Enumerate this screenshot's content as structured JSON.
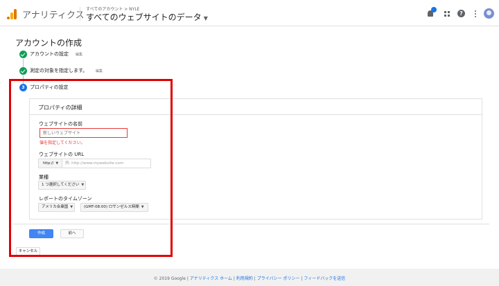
{
  "header": {
    "app_name": "アナリティクス",
    "breadcrumb": "すべてのアカウント > NYLE",
    "property_selector": "すべてのウェブサイトのデータ",
    "brand_color": "#e37400",
    "notification_badge_color": "#1a73e8",
    "icons": [
      "analytics-logo",
      "bell-icon",
      "apps-grid-icon",
      "help-icon",
      "more-vert-icon",
      "avatar"
    ]
  },
  "page": {
    "title": "アカウントの作成",
    "steps": [
      {
        "label": "アカウントの設定",
        "edit": "編集",
        "status": "complete"
      },
      {
        "label": "測定の対象を指定します。",
        "edit": "編集",
        "status": "complete"
      },
      {
        "label": "プロパティの設定",
        "number": "3",
        "status": "active"
      }
    ]
  },
  "property_details": {
    "title": "プロパティの詳細",
    "website_name": {
      "label": "ウェブサイトの名前",
      "value": "",
      "placeholder": "新しいウェブサイト",
      "error": "値を指定してください。"
    },
    "website_url": {
      "label": "ウェブサイトの URL",
      "protocol": "http://",
      "placeholder": "例: http://www.mywebsite.com",
      "value": ""
    },
    "industry": {
      "label": "業種",
      "selected": "1 つ選択してください"
    },
    "timezone": {
      "label": "レポートのタイムゾーン",
      "country": "アメリカ合衆国",
      "zone": "(GMT-08:00) ロサンゼルス時間"
    }
  },
  "actions": {
    "create": "作成",
    "previous": "前へ",
    "cancel": "キャンセル"
  },
  "footer": {
    "copyright": "© 2019 Google",
    "links": [
      "アナリティクス ホーム",
      "利用規約",
      "プライバシー ポリシー",
      "フィードバックを送信"
    ],
    "separator": "|"
  },
  "colors": {
    "highlight_box": "#e00000",
    "primary_button": "#4285f4",
    "success_check": "#0f9d58",
    "error": "#e53935"
  }
}
